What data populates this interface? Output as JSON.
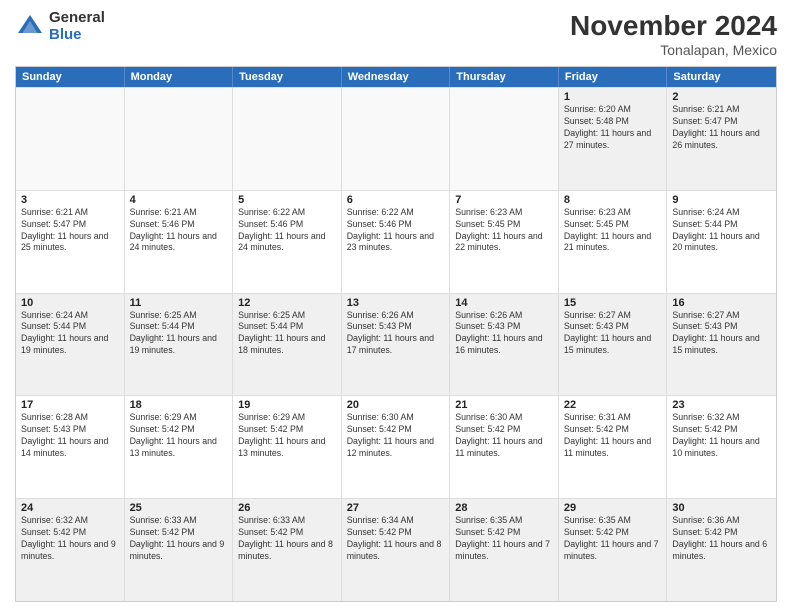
{
  "logo": {
    "general": "General",
    "blue": "Blue"
  },
  "title": "November 2024",
  "subtitle": "Tonalapan, Mexico",
  "days": [
    "Sunday",
    "Monday",
    "Tuesday",
    "Wednesday",
    "Thursday",
    "Friday",
    "Saturday"
  ],
  "weeks": [
    [
      {
        "num": "",
        "detail": ""
      },
      {
        "num": "",
        "detail": ""
      },
      {
        "num": "",
        "detail": ""
      },
      {
        "num": "",
        "detail": ""
      },
      {
        "num": "",
        "detail": ""
      },
      {
        "num": "1",
        "detail": "Sunrise: 6:20 AM\nSunset: 5:48 PM\nDaylight: 11 hours and 27 minutes."
      },
      {
        "num": "2",
        "detail": "Sunrise: 6:21 AM\nSunset: 5:47 PM\nDaylight: 11 hours and 26 minutes."
      }
    ],
    [
      {
        "num": "3",
        "detail": "Sunrise: 6:21 AM\nSunset: 5:47 PM\nDaylight: 11 hours and 25 minutes."
      },
      {
        "num": "4",
        "detail": "Sunrise: 6:21 AM\nSunset: 5:46 PM\nDaylight: 11 hours and 24 minutes."
      },
      {
        "num": "5",
        "detail": "Sunrise: 6:22 AM\nSunset: 5:46 PM\nDaylight: 11 hours and 24 minutes."
      },
      {
        "num": "6",
        "detail": "Sunrise: 6:22 AM\nSunset: 5:46 PM\nDaylight: 11 hours and 23 minutes."
      },
      {
        "num": "7",
        "detail": "Sunrise: 6:23 AM\nSunset: 5:45 PM\nDaylight: 11 hours and 22 minutes."
      },
      {
        "num": "8",
        "detail": "Sunrise: 6:23 AM\nSunset: 5:45 PM\nDaylight: 11 hours and 21 minutes."
      },
      {
        "num": "9",
        "detail": "Sunrise: 6:24 AM\nSunset: 5:44 PM\nDaylight: 11 hours and 20 minutes."
      }
    ],
    [
      {
        "num": "10",
        "detail": "Sunrise: 6:24 AM\nSunset: 5:44 PM\nDaylight: 11 hours and 19 minutes."
      },
      {
        "num": "11",
        "detail": "Sunrise: 6:25 AM\nSunset: 5:44 PM\nDaylight: 11 hours and 19 minutes."
      },
      {
        "num": "12",
        "detail": "Sunrise: 6:25 AM\nSunset: 5:44 PM\nDaylight: 11 hours and 18 minutes."
      },
      {
        "num": "13",
        "detail": "Sunrise: 6:26 AM\nSunset: 5:43 PM\nDaylight: 11 hours and 17 minutes."
      },
      {
        "num": "14",
        "detail": "Sunrise: 6:26 AM\nSunset: 5:43 PM\nDaylight: 11 hours and 16 minutes."
      },
      {
        "num": "15",
        "detail": "Sunrise: 6:27 AM\nSunset: 5:43 PM\nDaylight: 11 hours and 15 minutes."
      },
      {
        "num": "16",
        "detail": "Sunrise: 6:27 AM\nSunset: 5:43 PM\nDaylight: 11 hours and 15 minutes."
      }
    ],
    [
      {
        "num": "17",
        "detail": "Sunrise: 6:28 AM\nSunset: 5:43 PM\nDaylight: 11 hours and 14 minutes."
      },
      {
        "num": "18",
        "detail": "Sunrise: 6:29 AM\nSunset: 5:42 PM\nDaylight: 11 hours and 13 minutes."
      },
      {
        "num": "19",
        "detail": "Sunrise: 6:29 AM\nSunset: 5:42 PM\nDaylight: 11 hours and 13 minutes."
      },
      {
        "num": "20",
        "detail": "Sunrise: 6:30 AM\nSunset: 5:42 PM\nDaylight: 11 hours and 12 minutes."
      },
      {
        "num": "21",
        "detail": "Sunrise: 6:30 AM\nSunset: 5:42 PM\nDaylight: 11 hours and 11 minutes."
      },
      {
        "num": "22",
        "detail": "Sunrise: 6:31 AM\nSunset: 5:42 PM\nDaylight: 11 hours and 11 minutes."
      },
      {
        "num": "23",
        "detail": "Sunrise: 6:32 AM\nSunset: 5:42 PM\nDaylight: 11 hours and 10 minutes."
      }
    ],
    [
      {
        "num": "24",
        "detail": "Sunrise: 6:32 AM\nSunset: 5:42 PM\nDaylight: 11 hours and 9 minutes."
      },
      {
        "num": "25",
        "detail": "Sunrise: 6:33 AM\nSunset: 5:42 PM\nDaylight: 11 hours and 9 minutes."
      },
      {
        "num": "26",
        "detail": "Sunrise: 6:33 AM\nSunset: 5:42 PM\nDaylight: 11 hours and 8 minutes."
      },
      {
        "num": "27",
        "detail": "Sunrise: 6:34 AM\nSunset: 5:42 PM\nDaylight: 11 hours and 8 minutes."
      },
      {
        "num": "28",
        "detail": "Sunrise: 6:35 AM\nSunset: 5:42 PM\nDaylight: 11 hours and 7 minutes."
      },
      {
        "num": "29",
        "detail": "Sunrise: 6:35 AM\nSunset: 5:42 PM\nDaylight: 11 hours and 7 minutes."
      },
      {
        "num": "30",
        "detail": "Sunrise: 6:36 AM\nSunset: 5:42 PM\nDaylight: 11 hours and 6 minutes."
      }
    ]
  ]
}
